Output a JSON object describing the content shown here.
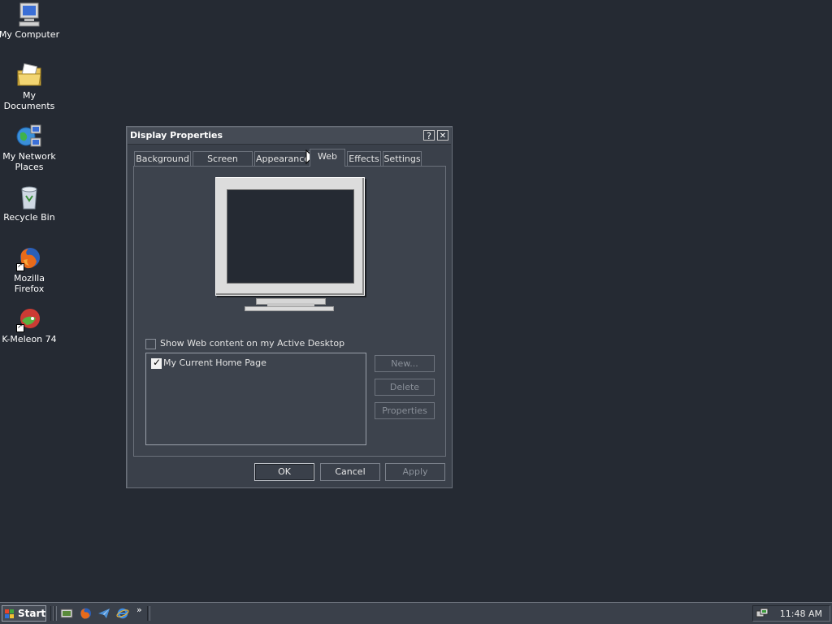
{
  "desktop": {
    "icons": [
      {
        "label": "My Computer",
        "icon": "my-computer-icon"
      },
      {
        "label": "My Documents",
        "icon": "my-documents-icon"
      },
      {
        "label": "My Network\nPlaces",
        "icon": "network-places-icon"
      },
      {
        "label": "Recycle Bin",
        "icon": "recycle-bin-icon"
      },
      {
        "label": "Mozilla Firefox",
        "icon": "firefox-icon"
      },
      {
        "label": "K-Meleon 74",
        "icon": "k-meleon-icon"
      }
    ]
  },
  "dialog": {
    "title": "Display Properties",
    "help_button": "?",
    "close_button": "✕",
    "tabs": [
      {
        "label": "Background",
        "active": false
      },
      {
        "label": "Screen Saver",
        "active": false
      },
      {
        "label": "Appearance",
        "active": false
      },
      {
        "label": "Web",
        "active": true
      },
      {
        "label": "Effects",
        "active": false
      },
      {
        "label": "Settings",
        "active": false
      }
    ],
    "show_web_content": {
      "label": "Show Web content on my Active Desktop",
      "checked": false
    },
    "web_items": [
      {
        "label": "My Current Home Page",
        "checked": true
      }
    ],
    "side_buttons": {
      "new": "New...",
      "delete": "Delete",
      "properties": "Properties"
    },
    "buttons": {
      "ok": "OK",
      "cancel": "Cancel",
      "apply": "Apply"
    }
  },
  "taskbar": {
    "start_label": "Start",
    "quick_launch": [
      "show-desktop-icon",
      "firefox-icon",
      "thunderbird-icon",
      "internet-explorer-icon"
    ],
    "chevron": "»",
    "clock": "11:48 AM"
  },
  "colors": {
    "desktop": "#252a33",
    "window": "#3a404a",
    "text": "#e8e8e8",
    "disabled_text": "#8a9099"
  }
}
